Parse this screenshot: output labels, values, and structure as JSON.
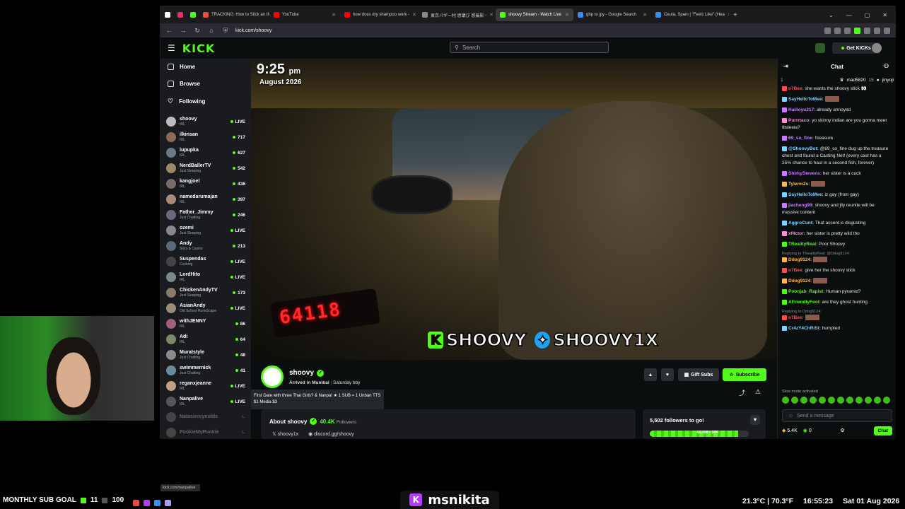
{
  "browser": {
    "tabs": [
      {
        "label": "",
        "icon": "x-icon",
        "color": "#ffffff"
      },
      {
        "label": "",
        "icon": "instagram-icon",
        "color": "#e1306c"
      },
      {
        "label": "",
        "icon": "kick-icon",
        "color": "#53fc18"
      },
      {
        "label": "TRACKING: How to Stick an IM...",
        "icon": "page-icon",
        "color": "#e74c3c"
      },
      {
        "label": "YouTube",
        "icon": "youtube-icon",
        "color": "#ff0000"
      },
      {
        "label": "how does dry shampoo work -",
        "icon": "youtube-icon",
        "color": "#ff0000"
      },
      {
        "label": "東京パギー村 思議び 感撮影 -",
        "icon": "search-icon",
        "color": "#888888"
      },
      {
        "label": "shoovy Stream - Watch Live",
        "icon": "kick-icon",
        "color": "#53fc18",
        "active": true
      },
      {
        "label": "gbp to jpy - Google Search",
        "icon": "google-icon",
        "color": "#4285f4"
      },
      {
        "label": "Ceuta, Spain | \"Feels Like\" (Hea",
        "icon": "weather-icon",
        "color": "#3b8eea"
      }
    ],
    "url": "kick.com/shoovy",
    "status_url": "kick.com/nanpalive"
  },
  "header": {
    "logo": "KICK",
    "search_placeholder": "Search",
    "get_kicks": "Get KICKs"
  },
  "sidebar": {
    "nav": [
      {
        "label": "Home",
        "icon": "home-icon"
      },
      {
        "label": "Browse",
        "icon": "browse-icon"
      },
      {
        "label": "Following",
        "icon": "heart-icon"
      }
    ],
    "channels": [
      {
        "name": "shoovy",
        "category": "IRL",
        "viewers": "LIVE",
        "live": true
      },
      {
        "name": "ilkinsan",
        "category": "IRL",
        "viewers": "717",
        "live": true
      },
      {
        "name": "lupupka",
        "category": "IRL",
        "viewers": "627",
        "live": true
      },
      {
        "name": "NerdBallerTV",
        "category": "Just Sleeping",
        "viewers": "542",
        "live": true
      },
      {
        "name": "kangjoel",
        "category": "IRL",
        "viewers": "436",
        "live": true
      },
      {
        "name": "namedarumajan",
        "category": "IRL",
        "viewers": "397",
        "live": true
      },
      {
        "name": "Father_Jimmy",
        "category": "Just Chatting",
        "viewers": "246",
        "live": true
      },
      {
        "name": "ozemi",
        "category": "Just Sleeping",
        "viewers": "LIVE",
        "live": true
      },
      {
        "name": "Andy",
        "category": "Slots & Casino",
        "viewers": "213",
        "live": true
      },
      {
        "name": "Suspendas",
        "category": "Cooking",
        "viewers": "LIVE",
        "live": true
      },
      {
        "name": "LordHito",
        "category": "IRL",
        "viewers": "LIVE",
        "live": true
      },
      {
        "name": "ChickenAndyTV",
        "category": "Just Sleeping",
        "viewers": "173",
        "live": true
      },
      {
        "name": "AsianAndy",
        "category": "Old School RuneScape",
        "viewers": "LIVE",
        "live": true
      },
      {
        "name": "withJENNY",
        "category": "IRL",
        "viewers": "86",
        "live": true
      },
      {
        "name": "Adi",
        "category": "IRL",
        "viewers": "64",
        "live": true
      },
      {
        "name": "Muratstyle",
        "category": "Just Chatting",
        "viewers": "48",
        "live": true
      },
      {
        "name": "swimmernick",
        "category": "Just Chatting",
        "viewers": "41",
        "live": true
      },
      {
        "name": "reganxjeanne",
        "category": "IRL",
        "viewers": "LIVE",
        "live": true
      },
      {
        "name": "Nanpalive",
        "category": "IRL",
        "viewers": "LIVE",
        "live": true
      },
      {
        "name": "Natasiereynolds",
        "category": "",
        "viewers": "",
        "live": false
      },
      {
        "name": "PookieMyPookie",
        "category": "",
        "viewers": "",
        "live": false
      }
    ]
  },
  "video": {
    "time": "9:25",
    "ampm": "pm",
    "date": "August 2026",
    "meter": "64118",
    "overlay_kick": "SHOOVY",
    "overlay_twitter": "SHOOVY1X"
  },
  "channel": {
    "name": "shoovy",
    "subtitle": "Arrived in Mumbai",
    "subtitle2": "Saturday bby",
    "stream_title": "First Date with three Thai Girls? & Nanpa! ★ 1 SUB = 1 Unban TTS $1 Media $3",
    "gift_subs": "Gift Subs",
    "subscribe": "Subscribe",
    "about_label": "About shoovy",
    "followers": "40.4K",
    "followers_word": "Followers",
    "twitter": "shoovy1x",
    "discord": "discord.gg/shoovy",
    "goal_text": "5,502 followers to go!",
    "goal_progress": "44,498 / 50K",
    "goal_fraction": 0.89
  },
  "chat": {
    "title": "Chat",
    "pinned_rank": "1",
    "pinned_user1": "mad5820",
    "pinned_count": "15",
    "pinned_user2": "jinyoji",
    "messages": [
      {
        "reply": "",
        "user": "o7Bee:",
        "color": "#ff4d4d",
        "text": "she wants the shoovy stick 👀"
      },
      {
        "reply": "",
        "user": "SayHelloToMee:",
        "color": "#7ed3ff",
        "text": ""
      },
      {
        "reply": "",
        "user": "Haiiloyu217:",
        "color": "#c77dff",
        "text": "already annoyed"
      },
      {
        "reply": "",
        "user": "Purrrtaco:",
        "color": "#ff8ad8",
        "text": "yo skinny indian are you gonna meet tltsleela?"
      },
      {
        "reply": "",
        "user": "69_so_fine:",
        "color": "#c77dff",
        "text": "!treasure"
      },
      {
        "reply": "",
        "user": "@ShoovyBot:",
        "color": "#7ed3ff",
        "text": "@69_so_fine dug up the treasure chest and found a Casting Net! (every cast has a 25% chance to haul in a second fish, forever)"
      },
      {
        "reply": "",
        "user": "ShirkyStevens:",
        "color": "#c77dff",
        "text": "her sister is a cuck"
      },
      {
        "reply": "",
        "user": "Tylerm2s:",
        "color": "#ffb84d",
        "text": ""
      },
      {
        "reply": "",
        "user": "SayHelloToMee:",
        "color": "#7ed3ff",
        "text": "iz gay (from gay)"
      },
      {
        "reply": "",
        "user": "jiacheng99:",
        "color": "#c77dff",
        "text": "shoovy and jlly reunite will be massive content"
      },
      {
        "reply": "",
        "user": "AggroCunt:",
        "color": "#7ed3ff",
        "text": "That accent is disgusting"
      },
      {
        "reply": "",
        "user": "xf4ctor:",
        "color": "#ff8ad8",
        "text": "her sister is pretty wild tho"
      },
      {
        "reply": "",
        "user": "TRealityReal:",
        "color": "#53fc18",
        "text": "Poor Shoovy"
      },
      {
        "reply": "Replying to TRealityReal: @Ddog9124:",
        "user": "Ddog9124:",
        "color": "#ffb84d",
        "text": ""
      },
      {
        "reply": "",
        "user": "o7Bee:",
        "color": "#ff4d4d",
        "text": "give her the shoovy stick"
      },
      {
        "reply": "",
        "user": "Ddog9124:",
        "color": "#ffb84d",
        "text": ""
      },
      {
        "reply": "",
        "user": "Poonjab_Rapist:",
        "color": "#53fc18",
        "text": "Human pyramid?"
      },
      {
        "reply": "",
        "user": "AFriendlyFool:",
        "color": "#53fc18",
        "text": "are they ghost hunting"
      },
      {
        "reply": "Replying to Ddog9124:",
        "user": "o7Bee:",
        "color": "#ff4d4d",
        "text": ""
      },
      {
        "reply": "",
        "user": "Cr4zY4ChRiSt:",
        "color": "#7ed3ff",
        "text": "humpted"
      }
    ],
    "slow_mode": "Slow mode activated",
    "input_placeholder": "Send a message",
    "viewer_count": "5.4K",
    "kicks_count": "0",
    "chat_button": "Chat"
  },
  "stream_overlay": {
    "sub_goal_label": "MONTHLY SUB GOAL",
    "sub_goal_current": "11",
    "sub_goal_target": "100",
    "streamer_name": "msnikita",
    "weather": "21.3°C | 70.3°F",
    "clock": "16:55:23",
    "date": "Sat 01 Aug 2026"
  },
  "colors": {
    "kick_green": "#53fc18",
    "bg": "#0b0e0f",
    "panel": "#191b1f"
  }
}
